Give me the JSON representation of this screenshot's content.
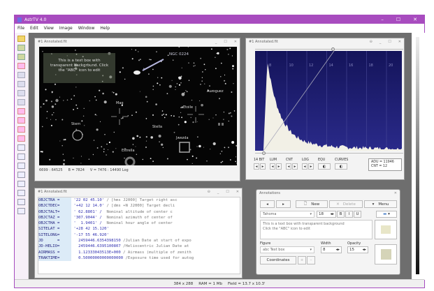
{
  "app": {
    "title": "AstrTV 4.0",
    "controls": [
      "–",
      "☐",
      "✕"
    ]
  },
  "menu": [
    "File",
    "Edit",
    "View",
    "Image",
    "Window",
    "Help"
  ],
  "toolbar_icons": [
    "open-folder-icon",
    "save-icon",
    "save-as-icon",
    "image-icon",
    "rotate-icon",
    "stars-icon",
    "copy-icon",
    "paste-icon",
    "split-h-icon",
    "split-v-icon",
    "corner-icon",
    "corner2-icon",
    "frame-icon",
    "zoom-fit-icon",
    "center-icon",
    "crop-icon",
    "fullframe-icon",
    "zoom-in-icon",
    "zoom-out-icon",
    "fit-icon"
  ],
  "image_window": {
    "title": "#1 Annotated.fit",
    "status": "6699 : 64525     B = 7824     V = 7476 : 14490 Log",
    "textbox": "This is a text box with transparent background. Click the \"ABC\" icon to edit",
    "labels": {
      "arrow": "NGC 0224",
      "mag": "Mag",
      "etoile": "Etoile",
      "aurora": "Auroguez",
      "stella": "Stella",
      "stern": "Stern",
      "jwezda": "Jwezda",
      "estrella": "Estrella",
      "star": "Ⅲ Ⅲ"
    }
  },
  "histogram_window": {
    "title": "#1 Annotated.fit",
    "axis_ticks": [
      "8",
      "10",
      "12",
      "14",
      "16",
      "18",
      "20"
    ],
    "controls": [
      {
        "label": "14 BIT",
        "buttons": [
          "◂",
          "▸"
        ]
      },
      {
        "label": "LUM",
        "buttons": [
          "◂",
          "▸"
        ]
      },
      {
        "label": "CNT",
        "buttons": [
          "◂",
          "▸"
        ]
      },
      {
        "label": "LOG",
        "buttons": [
          "◂",
          "▸"
        ]
      },
      {
        "label": "EQU"
      },
      {
        "label": "CURVES"
      }
    ],
    "readout": {
      "adu": "ADU = 11946",
      "cnt": "CNT = 12"
    }
  },
  "header_window": {
    "title": "#1 Annotated.fit",
    "rows": [
      {
        "key": "OBJCTRA =",
        "val": "'22 02 45.10'",
        "comment": "/ [hms J2000] Target right asc"
      },
      {
        "key": "OBJCTDEC=",
        "val": "'+42 12 14.0'",
        "comment": "/ [dms +N J2000] Target decli"
      },
      {
        "key": "OBJCTALT=",
        "val": "' 62.8801' /",
        "comment": " Nominal altitude of center c"
      },
      {
        "key": "OBJCTAZ =",
        "val": "'307.9044' /",
        "comment": " Nominal azimuth of center of"
      },
      {
        "key": "OBJCTHA =",
        "val": "'  1.9401' /",
        "comment": " Nominal hour angle of center"
      },
      {
        "key": "SITELAT =",
        "val": "'+28 42 15.120'",
        "comment": ""
      },
      {
        "key": "SITELONG=",
        "val": "'-17 55 46.920'",
        "comment": ""
      },
      {
        "key": "JD      =",
        "val": "  2459446.6354398150",
        "comment": "/Julian Date at start of expo"
      },
      {
        "key": "JD-HELIO=",
        "val": "  2459446.6395100807",
        "comment": "/Heliocentric Julian Date at"
      },
      {
        "key": "AIRMASS =",
        "val": "  1.12333043513E+000",
        "comment": "/ Airmass (multiple of zenith"
      },
      {
        "key": "TRAKTIME=",
        "val": "  0.50000000000000000",
        "comment": "/Exposure time used for autog"
      }
    ]
  },
  "annotations": {
    "title": "Annotations",
    "prev": "◂",
    "next": "▸",
    "new": "New",
    "delete": "Delete",
    "menu": "Menu",
    "font": "Tahoma",
    "font_size": "18",
    "bold": "B",
    "italic": "I",
    "underline": "U",
    "text": "This is a text box with transparent background\nClick the \"ABC\" icon to edit",
    "figure_label": "Figure",
    "figure_value": "Text box",
    "width_label": "Width",
    "width_value": "8",
    "opacity_label": "Opacity",
    "opacity_value": "15",
    "coordinates": "Coordinates",
    "plus": "+",
    "minus": "–",
    "swatch_color": "#e8e6c8"
  },
  "status": {
    "size": "384 x 288",
    "ram": "RAM = 1 Mb",
    "field": "Field = 13.7 x 10.3'"
  },
  "colors": {
    "title_bar": "#a84cbf",
    "histogram_bg": "#1c1c6a"
  }
}
